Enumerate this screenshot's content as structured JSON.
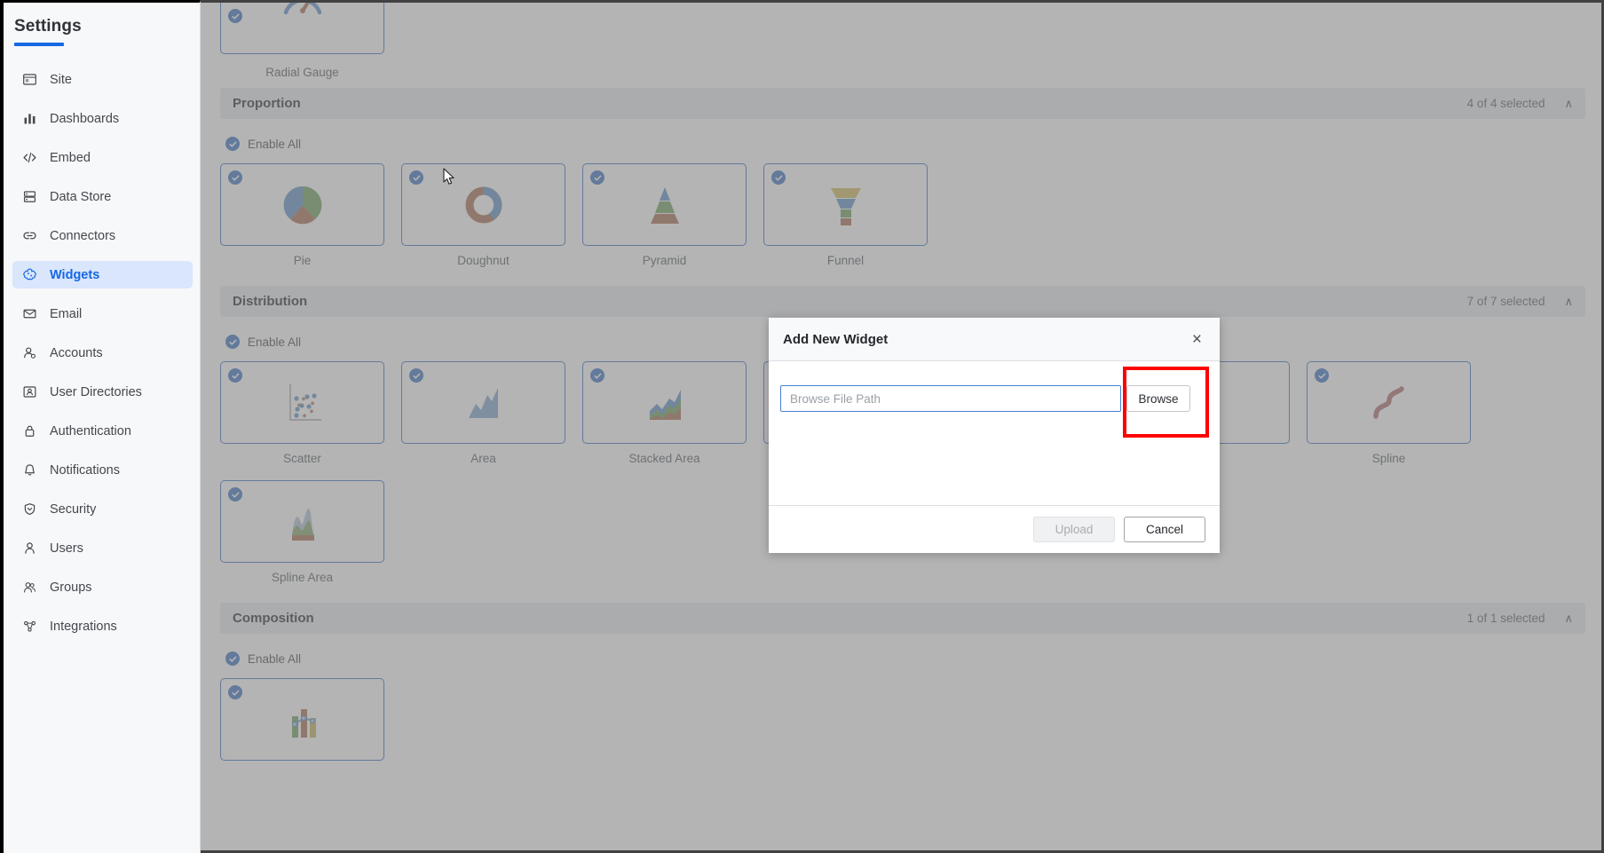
{
  "sidebar": {
    "title": "Settings",
    "items": [
      {
        "label": "Site",
        "icon": "site-icon",
        "active": false
      },
      {
        "label": "Dashboards",
        "icon": "dashboards-icon",
        "active": false
      },
      {
        "label": "Embed",
        "icon": "embed-code-icon",
        "active": false
      },
      {
        "label": "Data Store",
        "icon": "data-store-icon",
        "active": false
      },
      {
        "label": "Connectors",
        "icon": "link-icon",
        "active": false
      },
      {
        "label": "Widgets",
        "icon": "widgets-icon",
        "active": true
      },
      {
        "label": "Email",
        "icon": "envelope-icon",
        "active": false
      },
      {
        "label": "Accounts",
        "icon": "accounts-icon",
        "active": false
      },
      {
        "label": "User Directories",
        "icon": "user-directories-icon",
        "active": false
      },
      {
        "label": "Authentication",
        "icon": "lock-icon",
        "active": false
      },
      {
        "label": "Notifications",
        "icon": "bell-icon",
        "active": false
      },
      {
        "label": "Security",
        "icon": "shield-icon",
        "active": false
      },
      {
        "label": "Users",
        "icon": "user-icon",
        "active": false
      },
      {
        "label": "Groups",
        "icon": "group-icon",
        "active": false
      },
      {
        "label": "Integrations",
        "icon": "integrations-icon",
        "active": false
      }
    ]
  },
  "main": {
    "top_partial_widget": {
      "label": "Radial Gauge",
      "glyph": "radial-gauge-glyph",
      "checked": true
    },
    "enable_all_label": "Enable All",
    "collapse_chevron": "∧",
    "sections": [
      {
        "title": "Proportion",
        "count": "4 of 4 selected",
        "enable_all_label": "Enable All",
        "widgets": [
          {
            "label": "Pie",
            "glyph": "pie-glyph",
            "checked": true
          },
          {
            "label": "Doughnut",
            "glyph": "doughnut-glyph",
            "checked": true
          },
          {
            "label": "Pyramid",
            "glyph": "pyramid-glyph",
            "checked": true
          },
          {
            "label": "Funnel",
            "glyph": "funnel-glyph",
            "checked": true
          }
        ]
      },
      {
        "title": "Distribution",
        "count": "7 of 7 selected",
        "enable_all_label": "Enable All",
        "widgets": [
          {
            "label": "Scatter",
            "glyph": "scatter-glyph",
            "checked": true
          },
          {
            "label": "Area",
            "glyph": "area-glyph",
            "checked": true
          },
          {
            "label": "Stacked Area",
            "glyph": "stacked-area-glyph",
            "checked": true
          },
          {
            "label": "",
            "glyph": "hidden-glyph",
            "checked": true
          },
          {
            "label": "",
            "glyph": "hidden-glyph",
            "checked": true
          },
          {
            "label": "",
            "glyph": "hidden-glyph",
            "checked": true
          },
          {
            "label": "Spline",
            "glyph": "spline-glyph",
            "checked": true
          }
        ],
        "widgets_row2": [
          {
            "label": "Spline Area",
            "glyph": "spline-area-glyph",
            "checked": true
          }
        ]
      },
      {
        "title": "Composition",
        "count": "1 of 1 selected",
        "enable_all_label": "Enable All",
        "widgets": [
          {
            "label": "",
            "glyph": "combination-glyph",
            "checked": true
          }
        ]
      }
    ]
  },
  "modal": {
    "title": "Add New Widget",
    "close_label": "×",
    "file_path_value": "",
    "file_path_placeholder": "Browse File Path",
    "browse_label": "Browse",
    "upload_label": "Upload",
    "cancel_label": "Cancel"
  },
  "annotation": {
    "highlight_color": "#ff0000",
    "highlight_target": "browse-button"
  },
  "colors": {
    "accent": "#1668e3",
    "card_border": "#4d7ec8",
    "checkbox": "#4d7ec8",
    "section_header_bg": "#eceef0",
    "sidebar_bg": "#f7f8fa",
    "overlay": "rgba(119,119,119,0.55)"
  }
}
